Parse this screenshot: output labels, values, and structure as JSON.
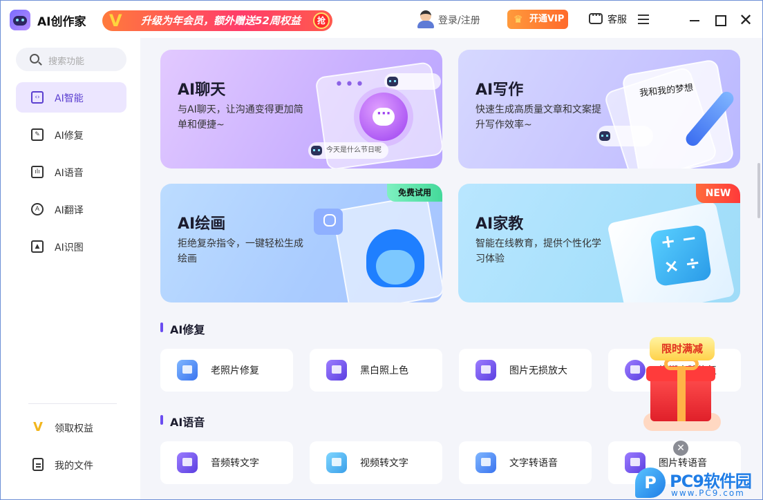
{
  "app": {
    "name": "AI创作家"
  },
  "header": {
    "banner_text": "升级为年会员，额外赠送52周权益",
    "banner_badge": "抢",
    "login_label": "登录/注册",
    "vip_label": "开通VIP",
    "service_label": "客服"
  },
  "sidebar": {
    "search_placeholder": "搜索功能",
    "items": [
      {
        "label": "AI智能",
        "icon": "ai-chip-icon"
      },
      {
        "label": "AI修复",
        "icon": "image-repair-icon"
      },
      {
        "label": "AI语音",
        "icon": "voice-icon"
      },
      {
        "label": "AI翻译",
        "icon": "translate-icon"
      },
      {
        "label": "AI识图",
        "icon": "image-recognize-icon"
      }
    ],
    "bottom": [
      {
        "label": "领取权益",
        "icon": "vip-v-icon"
      },
      {
        "label": "我的文件",
        "icon": "file-icon"
      }
    ]
  },
  "cards": [
    {
      "title": "AI聊天",
      "desc": "与AI聊天，让沟通变得更加简单和便捷~",
      "chip": "今天是什么节日呢"
    },
    {
      "title": "AI写作",
      "desc": "快速生成高质量文章和文案提升写作效率~",
      "doc_text": "我和我的梦想"
    },
    {
      "title": "AI绘画",
      "desc": "拒绝复杂指令，一键轻松生成绘画",
      "tag": "免费试用"
    },
    {
      "title": "AI家教",
      "desc": "智能在线教育，提供个性化学习体验",
      "tag": "NEW"
    }
  ],
  "sections": [
    {
      "title": "AI修复",
      "tools": [
        "老照片修复",
        "黑白照上色",
        "图片无损放大",
        "模糊人脸修复"
      ]
    },
    {
      "title": "AI语音",
      "tools": [
        "音频转文字",
        "视频转文字",
        "文字转语音",
        "图片转语音"
      ]
    }
  ],
  "promo": {
    "tag": "限时满减"
  },
  "watermark": {
    "title": "PC9软件园",
    "url": "www.PC9.com"
  },
  "colors": {
    "accent": "#6a4cf0",
    "vip": "#ff7a3c",
    "banner": "#ff3d6a",
    "new_tag": "#ff3a3a",
    "free_tag": "#44d99a"
  }
}
